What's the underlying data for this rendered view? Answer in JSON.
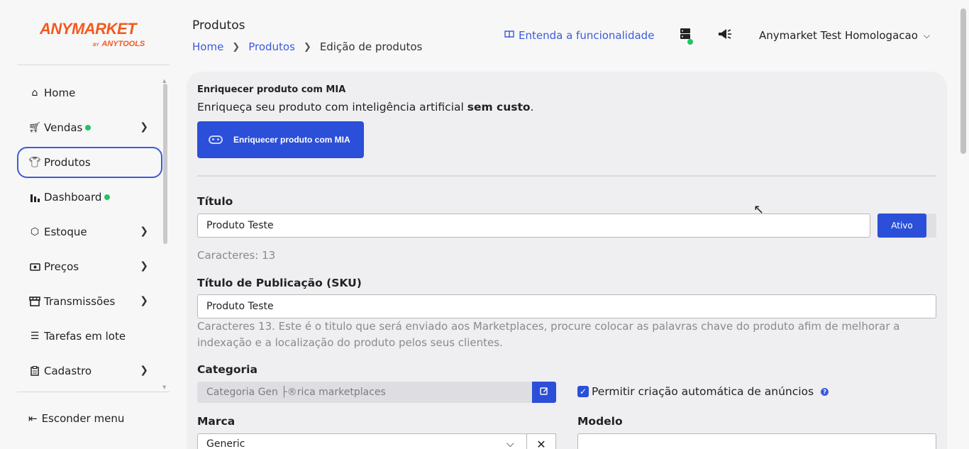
{
  "brand": {
    "name": "ANYMARKET",
    "by": "BY",
    "sub": "ANYTOOLS"
  },
  "sidebar": {
    "items": [
      {
        "label": "Home",
        "icon": "home-icon"
      },
      {
        "label": "Vendas",
        "icon": "cart-icon",
        "dot": true,
        "arrow": true
      },
      {
        "label": "Produtos",
        "icon": "shirt-icon",
        "active": true
      },
      {
        "label": "Dashboard",
        "icon": "bar-chart-icon",
        "dot": true
      },
      {
        "label": "Estoque",
        "icon": "box-icon",
        "arrow": true
      },
      {
        "label": "Preços",
        "icon": "money-icon",
        "arrow": true
      },
      {
        "label": "Transmissões",
        "icon": "store-icon",
        "arrow": true
      },
      {
        "label": "Tarefas em lote",
        "icon": "list-icon"
      },
      {
        "label": "Cadastro",
        "icon": "clipboard-icon",
        "arrow": true
      }
    ],
    "hide_menu": "Esconder menu"
  },
  "header": {
    "title": "Produtos",
    "breadcrumb": {
      "home": "Home",
      "products": "Produtos",
      "current": "Edição de produtos"
    },
    "help_link": "Entenda a funcionalidade",
    "user": "Anymarket Test Homologacao"
  },
  "mia": {
    "title": "Enriquecer produto com MIA",
    "desc_prefix": "Enriqueça seu produto com inteligência artificial ",
    "desc_bold": "sem custo",
    "desc_suffix": ".",
    "button": "Enriquecer produto com MIA"
  },
  "form": {
    "title_label": "Título",
    "title_value": "Produto Teste",
    "status": "Ativo",
    "title_chars": "Caracteres: 13",
    "sku_label": "Título de Publicação (SKU)",
    "sku_value": "Produto Teste",
    "sku_hint": "Caracteres 13. Este é o titulo que será enviado aos Marketplaces, procure colocar as palavras chave do produto afim de melhorar a indexação e a localização do produto pelos seus clientes.",
    "category_label": "Categoria",
    "category_value": "Categoria Gen ├®rica marketplaces",
    "auto_ads_label": "Permitir criação automática de anúncios",
    "brand_label": "Marca",
    "brand_value": "Generic",
    "model_label": "Modelo",
    "model_value": ""
  },
  "colors": {
    "accent": "#2b4fd8",
    "brand_orange": "#f25a1d",
    "online": "#22c55e"
  }
}
